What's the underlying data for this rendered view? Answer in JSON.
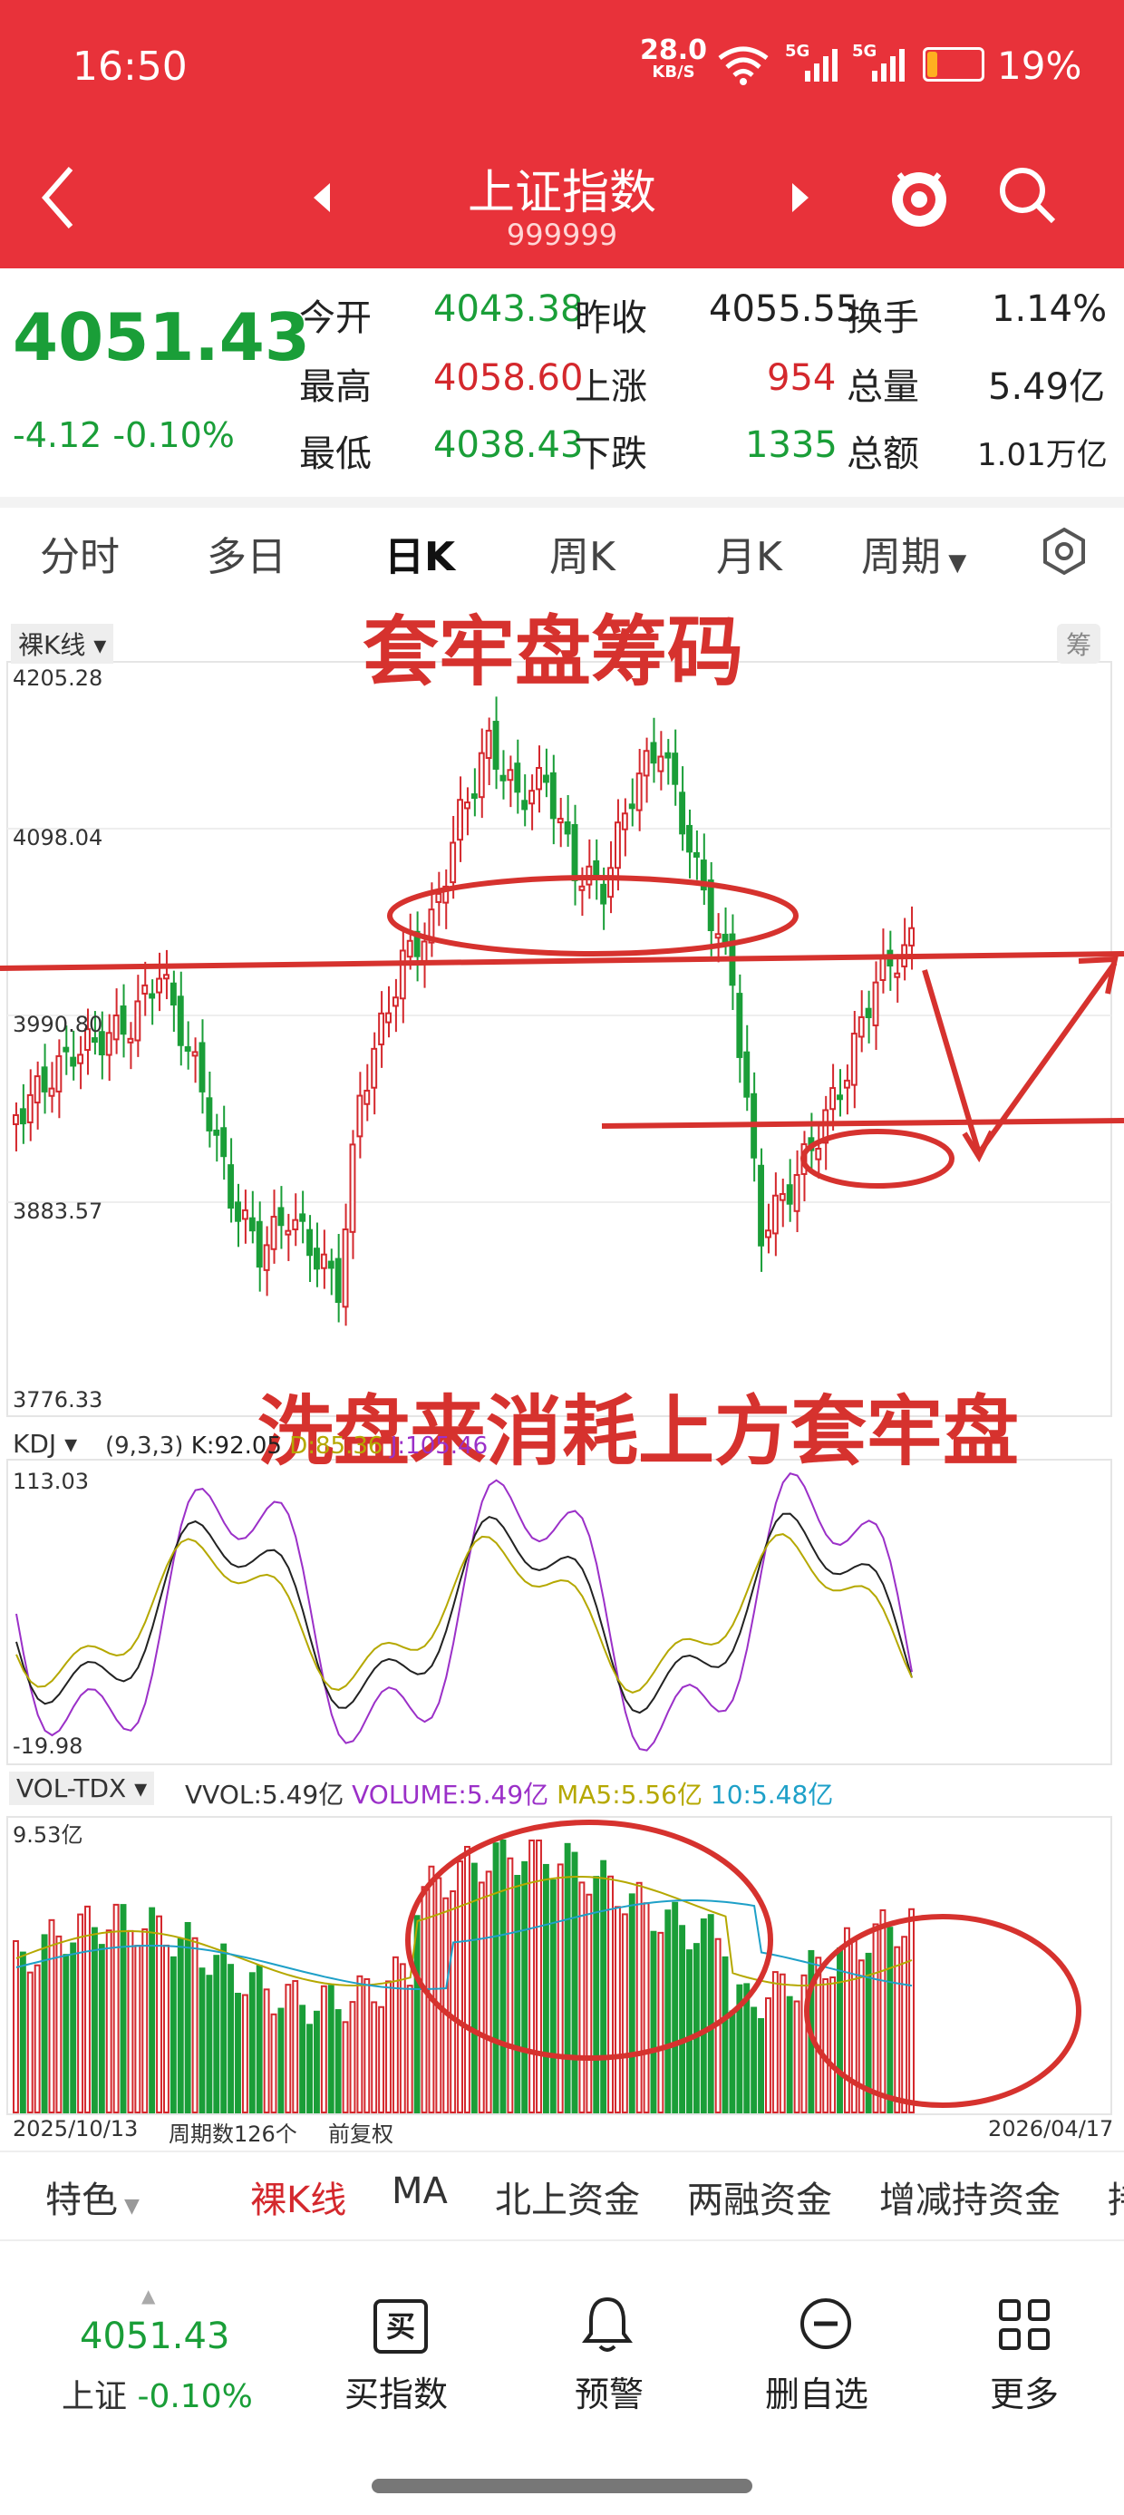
{
  "status_bar": {
    "time": "16:50",
    "net_speed": "28.0",
    "net_unit": "KB/S",
    "signal1": "5G",
    "signal2": "5G",
    "battery": "19%",
    "battery_level": 0.19
  },
  "header": {
    "title": "上证指数",
    "code": "999999"
  },
  "quote": {
    "price": "4051.43",
    "change": "-4.12",
    "change_pct": "-0.10%",
    "open_label": "今开",
    "open": "4043.38",
    "prev_label": "昨收",
    "prev": "4055.55",
    "turnover_label": "换手",
    "turnover": "1.14%",
    "high_label": "最高",
    "high": "4058.60",
    "up_label": "上涨",
    "up": "954",
    "vol_label": "总量",
    "vol": "5.49亿",
    "low_label": "最低",
    "low": "4038.43",
    "down_label": "下跌",
    "down": "1335",
    "amount_label": "总额",
    "amount": "1.01万亿"
  },
  "tabs": [
    "分时",
    "多日",
    "日K",
    "周K",
    "月K",
    "周期"
  ],
  "chart": {
    "kline_label": "裸K线",
    "chip_label": "筹",
    "y_top": "4205.28",
    "y_mid1": "4098.04",
    "y_mid2": "3990.80",
    "y_mid3": "3883.57",
    "y_bottom": "3776.33",
    "annotation_top": "套牢盘筹码",
    "annotation_bottom": "洗盘来消耗上方套牢盘",
    "kdj_label": "KDJ",
    "kdj_params": "(9,3,3)",
    "kdj_k": "K:92.05",
    "kdj_d": "D:85.36",
    "kdj_j": "J:105.46",
    "kdj_top": "113.03",
    "kdj_bottom": "-19.98",
    "vol_label": "VOL-TDX",
    "vvol": "VVOL:5.49亿",
    "volume": "VOLUME:5.49亿",
    "ma5": "MA5:5.56亿",
    "ma10": "10:5.48亿",
    "vol_top": "9.53亿",
    "date_start": "2025/10/13",
    "periods": "周期数126个",
    "adj": "前复权",
    "date_end": "2026/04/17",
    "colors": {
      "up": "#d4282d",
      "down": "#1a9e38",
      "annotation": "#d6322e"
    }
  },
  "bottom_tabs": [
    "特色",
    "裸K线",
    "MA",
    "北上资金",
    "两融资金",
    "增减持资金",
    "持"
  ],
  "nav": {
    "price": "4051.43",
    "sub_name": "上证",
    "sub_pct": "-0.10%",
    "items": [
      "买指数",
      "预警",
      "删自选",
      "更多"
    ],
    "buy_glyph": "买"
  }
}
